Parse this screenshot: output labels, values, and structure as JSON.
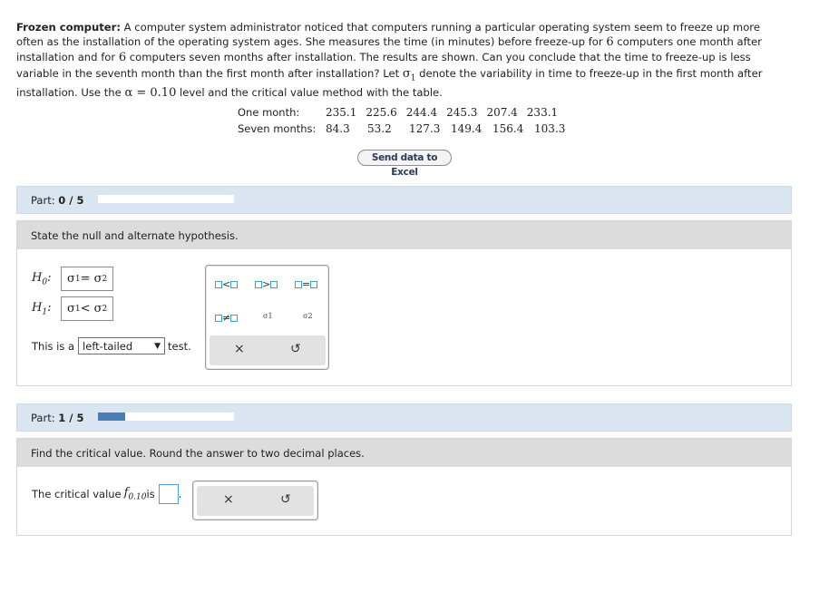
{
  "problem": {
    "title": "Frozen computer:",
    "text_1": " A computer system administrator noticed that computers running a particular operating system seem to freeze up more often as the installation of the operating system ages. She measures the time (in minutes) before freeze-up for ",
    "n1": "6",
    "text_2": " computers one month after installation and for ",
    "n2": "6",
    "text_3": " computers seven months after installation. The results are shown. Can you conclude that the time to freeze-up is less variable in the seventh month than the first month after installation? Let ",
    "sigma": "σ",
    "sigma_sub": "1",
    "text_4": " denote the variability in time to freeze-up in the first month after installation. Use the ",
    "alpha": "α = 0.10",
    "text_5": " level and the critical value method with the table."
  },
  "data_table": {
    "rows": [
      {
        "label": "One month:",
        "values": [
          "235.1",
          "225.6",
          "244.4",
          "245.3",
          "207.4",
          "233.1"
        ]
      },
      {
        "label": "Seven months:",
        "values": [
          "84.3",
          "53.2",
          "127.3",
          "149.4",
          "156.4",
          "103.3"
        ]
      }
    ]
  },
  "excel_button": "Send data to Excel",
  "part0": {
    "prefix": "Part: ",
    "progress_text": "0 / 5",
    "progress": 0.0
  },
  "section1": {
    "heading": "State the null and alternate hypothesis.",
    "h0_label": "H",
    "h0_sub": "0",
    "h0_expr": "σ",
    "h0_expr_sub1": "1",
    "h0_op": " = σ",
    "h0_expr_sub2": "2",
    "h1_label": "H",
    "h1_sub": "1",
    "h1_expr": "σ",
    "h1_expr_sub1": "1",
    "h1_op": " < σ",
    "h1_expr_sub2": "2",
    "test_prefix": "This is a",
    "test_value": "left-tailed",
    "test_suffix": "test.",
    "palette": {
      "lt": "<",
      "gt": ">",
      "eq": "=",
      "ne": "≠",
      "sigma1": "σ1",
      "sigma2": "σ2",
      "clear": "×",
      "undo": "↺"
    }
  },
  "part1": {
    "prefix": "Part: ",
    "progress_text": "1 / 5",
    "progress": 0.2
  },
  "section2": {
    "heading": "Find the critical value. Round the answer to two decimal places.",
    "crit_prefix": "The critical value ",
    "crit_f": "f",
    "crit_sub": "0.10",
    "crit_is": " is",
    "crit_suffix": ".",
    "clear": "×",
    "undo": "↺"
  }
}
